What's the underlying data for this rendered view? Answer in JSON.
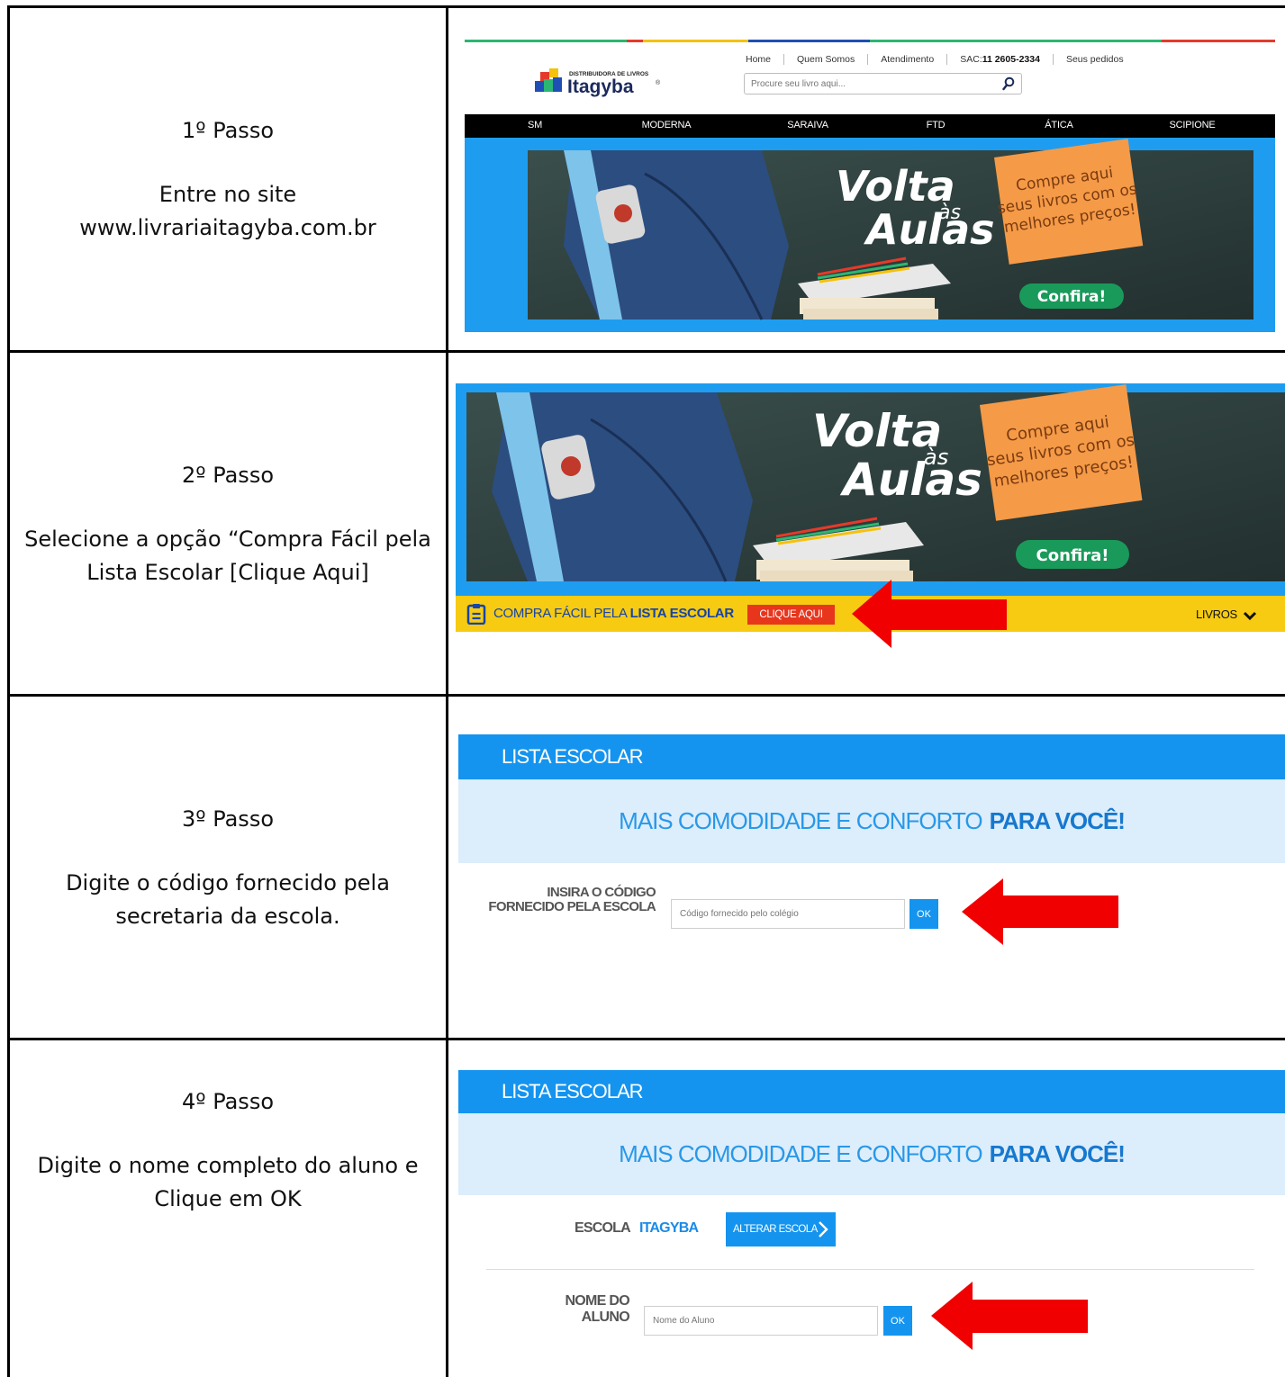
{
  "steps": [
    {
      "title": "1º Passo",
      "line1": "Entre no site",
      "line2": "www.livrariaitagyba.com.br"
    },
    {
      "title": "2º Passo",
      "line1": "Selecione a opção “Compra Fácil pela",
      "line2": "Lista Escolar [Clique Aqui]"
    },
    {
      "title": "3º Passo",
      "line1": "Digite o código fornecido pela",
      "line2": "secretaria da escola."
    },
    {
      "title": "4º Passo",
      "line1": "Digite o nome completo do aluno e",
      "line2": "Clique em OK"
    }
  ],
  "site": {
    "logo_small": "DISTRIBUIDORA DE LIVROS",
    "logo_name": "Itagyba",
    "logo_reg": "®",
    "topnav": {
      "home": "Home",
      "quem": "Quem Somos",
      "atendimento": "Atendimento",
      "sac_label": "SAC: ",
      "sac_number": "11 2605-2334",
      "pedidos": "Seus pedidos"
    },
    "search_placeholder": "Procure seu livro aqui...",
    "publishers": [
      "SM",
      "MODERNA",
      "SARAIVA",
      "FTD",
      "ÁTICA",
      "SCIPIONE"
    ],
    "stripe_colors": [
      "#2bb673",
      "#e53a2b",
      "#f4c20d",
      "#1f4fb5",
      "#2bb673",
      "#e53a2b"
    ]
  },
  "banner": {
    "volta": "Volta",
    "as": "às",
    "aulas": "Aulas",
    "note_line1": "Compre aqui",
    "note_line2": "seus livros com os",
    "note_line3": "melhores preços!",
    "cta": "Confira!"
  },
  "bar": {
    "label_a": "COMPRA FÁCIL PELA ",
    "label_b": "LISTA ESCOLAR",
    "button": "CLIQUE AQUI",
    "livros": "LIVROS"
  },
  "lista": {
    "header": "LISTA ESCOLAR",
    "sub_a": "MAIS COMODIDADE E CONFORTO",
    "sub_b": "PARA VOCÊ!",
    "code_label_1": "INSIRA O CÓDIGO",
    "code_label_2": "FORNECIDO PELA ESCOLA",
    "code_placeholder": "Código fornecido pelo colégio",
    "ok": "OK",
    "escola_label": "ESCOLA",
    "escola_value": "ITAGYBA",
    "alterar": "ALTERAR ESCOLA",
    "nome_label_1": "NOME DO",
    "nome_label_2": "ALUNO",
    "nome_placeholder": "Nome do Aluno"
  },
  "colors": {
    "blue": "#1494ef",
    "yellow": "#f6cb12",
    "red": "#e8361d",
    "arrow": "#f00000"
  }
}
